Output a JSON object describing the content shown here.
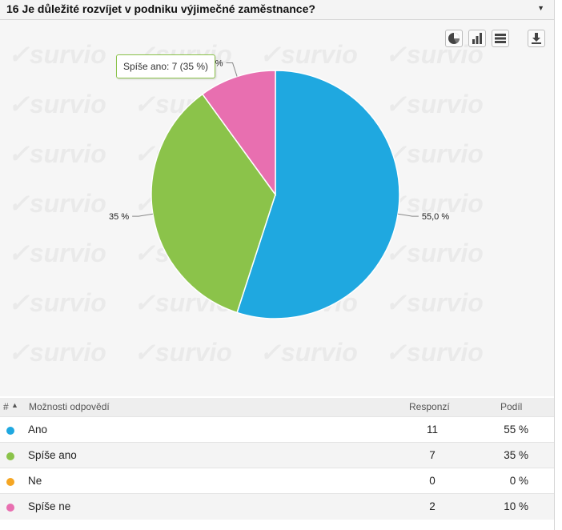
{
  "question": {
    "title": "16 Je důležité rozvíjet v podniku výjimečné zaměstnance?"
  },
  "watermark": "survio",
  "toolbar": {
    "icons": [
      "pie-chart-icon",
      "bar-chart-icon",
      "table-icon",
      "download-icon"
    ]
  },
  "chart_data": {
    "type": "pie",
    "categories": [
      "Ano",
      "Spíše ano",
      "Ne",
      "Spíše ne"
    ],
    "values": [
      11,
      7,
      0,
      2
    ],
    "percent_labels": [
      "55,0 %",
      "35 %",
      "",
      "%"
    ],
    "colors": [
      "#1fa8e0",
      "#8bc34a",
      "#f5a623",
      "#e86fb0"
    ],
    "tooltip": "Spíše ano: 7 (35 %)"
  },
  "table": {
    "headers": {
      "index": "#",
      "option": "Možnosti odpovědí",
      "responses": "Responzí",
      "share": "Podíl"
    },
    "rows": [
      {
        "label": "Ano",
        "count": "11",
        "pct": "55 %",
        "color": "#1fa8e0"
      },
      {
        "label": "Spíše ano",
        "count": "7",
        "pct": "35 %",
        "color": "#8bc34a"
      },
      {
        "label": "Ne",
        "count": "0",
        "pct": "0 %",
        "color": "#f5a623"
      },
      {
        "label": "Spíše ne",
        "count": "2",
        "pct": "10 %",
        "color": "#e86fb0"
      }
    ]
  }
}
